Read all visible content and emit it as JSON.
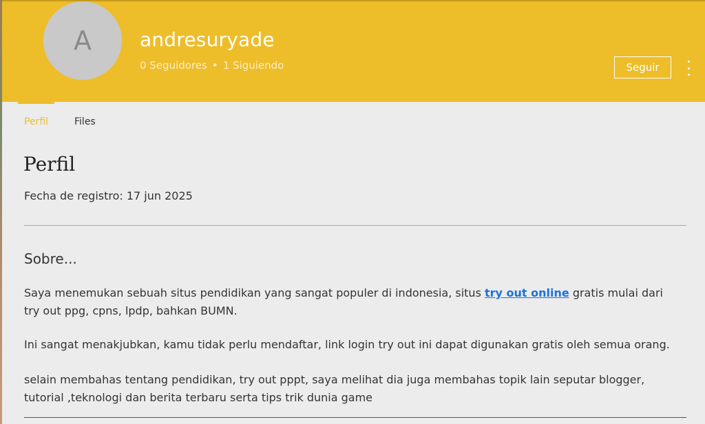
{
  "profile": {
    "avatar_letter": "A",
    "username": "andresuryade",
    "followers": "0 Seguidores",
    "following": "1 Siguiendo",
    "separator": "•",
    "follow_label": "Seguir",
    "more_icon": "more-vertical-icon",
    "header_color": "#edbd2a"
  },
  "tabs": [
    {
      "label": "Perfil",
      "active": true
    },
    {
      "label": "Files",
      "active": false
    }
  ],
  "main": {
    "title": "Perfil",
    "registration": "Fecha de registro: 17 jun 2025",
    "about_title": "Sobre...",
    "para1_before": "Saya menemukan sebuah situs pendidikan yang sangat populer di indonesia, situs ",
    "para1_link": " try out online",
    "para1_after": " gratis mulai dari try out ppg, cpns, lpdp, bahkan BUMN.",
    "para2": "Ini sangat menakjubkan, kamu tidak perlu mendaftar, link login try out ini dapat digunakan gratis oleh semua orang.",
    "para3": "selain membahas tentang pendidikan, try out pppt, saya melihat dia juga membahas topik lain seputar blogger, tutorial ,teknologi dan berita terbaru serta tips trik dunia game",
    "link_color": "#1a73d9"
  }
}
